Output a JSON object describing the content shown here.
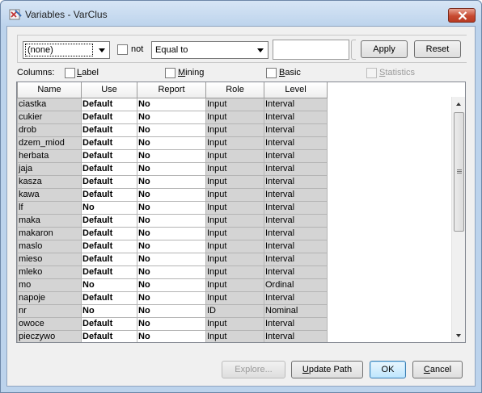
{
  "window": {
    "title": "Variables - VarClus"
  },
  "filter": {
    "field_value": "(none)",
    "not_label": "not",
    "operator_value": "Equal to",
    "value_input": "",
    "apply_label": "Apply",
    "reset_label": "Reset"
  },
  "columns_bar": {
    "label": "Columns:",
    "options": [
      {
        "label": "Label",
        "mn": "L",
        "rest": "abel"
      },
      {
        "label": "Mining",
        "mn": "M",
        "rest": "ining"
      },
      {
        "label": "Basic",
        "mn": "B",
        "rest": "asic"
      },
      {
        "label": "Statistics",
        "mn": "S",
        "rest": "tatistics"
      }
    ]
  },
  "table": {
    "headers": [
      "Name",
      "Use",
      "Report",
      "Role",
      "Level"
    ],
    "rows": [
      [
        "ciastka",
        "Default",
        "No",
        "Input",
        "Interval"
      ],
      [
        "cukier",
        "Default",
        "No",
        "Input",
        "Interval"
      ],
      [
        "drob",
        "Default",
        "No",
        "Input",
        "Interval"
      ],
      [
        "dzem_miod",
        "Default",
        "No",
        "Input",
        "Interval"
      ],
      [
        "herbata",
        "Default",
        "No",
        "Input",
        "Interval"
      ],
      [
        "jaja",
        "Default",
        "No",
        "Input",
        "Interval"
      ],
      [
        "kasza",
        "Default",
        "No",
        "Input",
        "Interval"
      ],
      [
        "kawa",
        "Default",
        "No",
        "Input",
        "Interval"
      ],
      [
        "lf",
        "No",
        "No",
        "Input",
        "Interval"
      ],
      [
        "maka",
        "Default",
        "No",
        "Input",
        "Interval"
      ],
      [
        "makaron",
        "Default",
        "No",
        "Input",
        "Interval"
      ],
      [
        "maslo",
        "Default",
        "No",
        "Input",
        "Interval"
      ],
      [
        "mieso",
        "Default",
        "No",
        "Input",
        "Interval"
      ],
      [
        "mleko",
        "Default",
        "No",
        "Input",
        "Interval"
      ],
      [
        "mo",
        "No",
        "No",
        "Input",
        "Ordinal"
      ],
      [
        "napoje",
        "Default",
        "No",
        "Input",
        "Interval"
      ],
      [
        "nr",
        "No",
        "No",
        "ID",
        "Nominal"
      ],
      [
        "owoce",
        "Default",
        "No",
        "Input",
        "Interval"
      ],
      [
        "pieczywo",
        "Default",
        "No",
        "Input",
        "Interval"
      ]
    ]
  },
  "buttons": {
    "explore": "Explore...",
    "update_path": "Update Path",
    "ok": "OK",
    "cancel": "Cancel"
  }
}
